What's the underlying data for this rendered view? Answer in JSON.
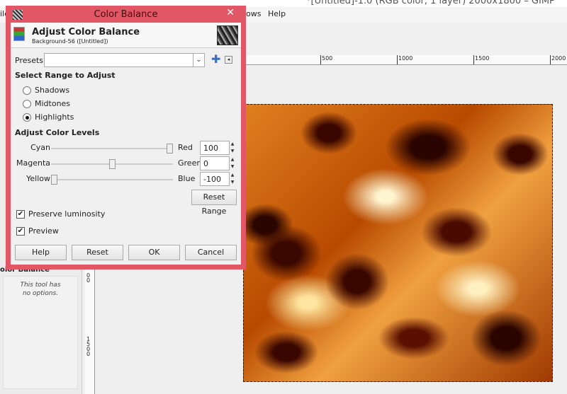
{
  "window": {
    "title": "*[Untitled]-1.0 (RGB color, 1 layer) 2000x1800 – GIMP"
  },
  "menubar": {
    "items": [
      "ile",
      "lows",
      "Help"
    ]
  },
  "rulers": {
    "horizontal": [
      "500",
      "1000",
      "1500",
      "2000"
    ],
    "vertical": [
      "00",
      "1500"
    ]
  },
  "tool_options": {
    "title": "olor Balance",
    "body_line1": "This tool has",
    "body_line2": "no options."
  },
  "dialog": {
    "title": "Color Balance",
    "header_title": "Adjust Color Balance",
    "header_subtitle": "Background-56 ([Untitled])",
    "presets_label": "Presets:",
    "presets_value": "",
    "range_heading": "Select Range to Adjust",
    "ranges": [
      {
        "label": "Shadows",
        "selected": false
      },
      {
        "label": "Midtones",
        "selected": false
      },
      {
        "label": "Highlights",
        "selected": true
      }
    ],
    "levels_heading": "Adjust Color Levels",
    "levels": [
      {
        "left": "Cyan",
        "right": "Red",
        "value": "100",
        "fraction": 1.0
      },
      {
        "left": "Magenta",
        "right": "Green",
        "value": "0",
        "fraction": 0.5
      },
      {
        "left": "Yellow",
        "right": "Blue",
        "value": "-100",
        "fraction": 0.0
      }
    ],
    "reset_range": "Reset Range",
    "preserve_luminosity": {
      "label": "Preserve luminosity",
      "checked": true
    },
    "preview": {
      "label": "Preview",
      "checked": true
    },
    "buttons": {
      "help": "Help",
      "reset": "Reset",
      "ok": "OK",
      "cancel": "Cancel"
    }
  },
  "colors": {
    "dialog_border": "#e25765"
  }
}
